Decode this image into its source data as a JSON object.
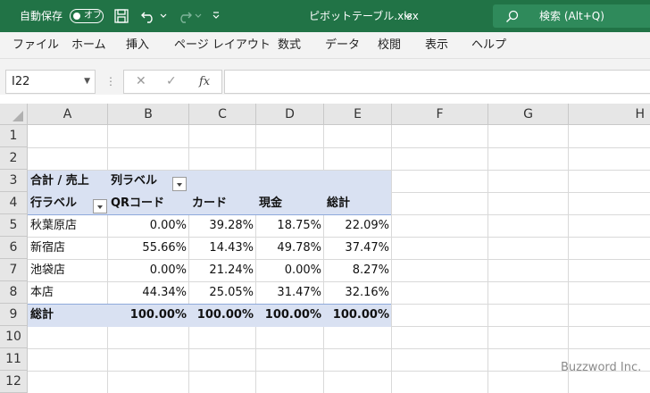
{
  "titlebar": {
    "autosave_label": "自動保存",
    "autosave_state": "オフ",
    "file_name": "ピボットテーブル.xlsx",
    "search_placeholder": "検索 (Alt+Q)"
  },
  "ribbon": {
    "tabs": [
      "ファイル",
      "ホーム",
      "挿入",
      "ページ レイアウト",
      "数式",
      "データ",
      "校閲",
      "表示",
      "ヘルプ"
    ]
  },
  "formula_bar": {
    "name_box": "I22",
    "formula": ""
  },
  "sheet": {
    "columns": [
      "A",
      "B",
      "C",
      "D",
      "E",
      "F",
      "G",
      "H"
    ],
    "rows": [
      "1",
      "2",
      "3",
      "4",
      "5",
      "6",
      "7",
      "8",
      "9",
      "10",
      "11",
      "12"
    ]
  },
  "pivot": {
    "value_field": "合計 / 売上",
    "column_labels": "列ラベル",
    "row_labels": "行ラベル",
    "headers": [
      "QRコード",
      "カード",
      "現金",
      "総計"
    ],
    "rows": [
      {
        "label": "秋葉原店",
        "values": [
          "0.00%",
          "39.28%",
          "18.75%",
          "22.09%"
        ]
      },
      {
        "label": "新宿店",
        "values": [
          "55.66%",
          "14.43%",
          "49.78%",
          "37.47%"
        ]
      },
      {
        "label": "池袋店",
        "values": [
          "0.00%",
          "21.24%",
          "0.00%",
          "8.27%"
        ]
      },
      {
        "label": "本店",
        "values": [
          "44.34%",
          "25.05%",
          "31.47%",
          "32.16%"
        ]
      }
    ],
    "total": {
      "label": "総計",
      "values": [
        "100.00%",
        "100.00%",
        "100.00%",
        "100.00%"
      ]
    }
  },
  "watermark": "Buzzword Inc.",
  "colors": {
    "title_bar": "#217346",
    "pivot_band": "#d9e1f2",
    "pivot_line": "#8ea9db"
  }
}
